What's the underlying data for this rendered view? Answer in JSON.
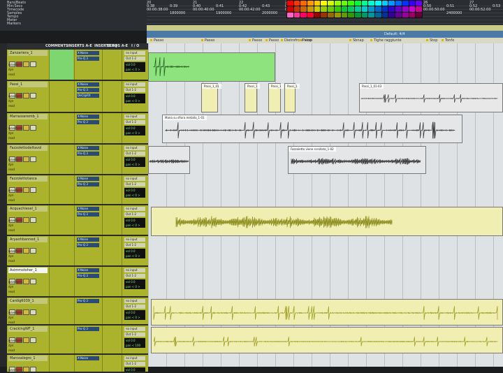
{
  "rulers": [
    {
      "label": "Bars|Beats",
      "ticks": [
        "20",
        "",
        "21",
        "",
        "22",
        "",
        "23",
        "",
        "24",
        "",
        "25",
        "",
        "26",
        "",
        "27",
        "",
        "28"
      ]
    },
    {
      "label": "Min:Secs",
      "ticks": [
        "0:38",
        "0:39",
        "0:40",
        "0:41",
        "0:42",
        "0:43",
        "0:44",
        "0:45",
        "0:46",
        "0:47",
        "0:48",
        "0:49",
        "0:50",
        "0:51",
        "0:52",
        "0:53"
      ]
    },
    {
      "label": "Timecode",
      "ticks": [
        "00:00:38:00",
        "",
        "00:00:40:00",
        "",
        "00:00:42:00",
        "",
        "00:00:44:00",
        "",
        "00:00:46:00",
        "",
        "00:00:48:00",
        "",
        "00:00:50:00",
        "",
        "00:00:52:00"
      ]
    },
    {
      "label": "Samples",
      "ticks": [
        "",
        "1800000",
        "",
        "1900000",
        "",
        "2000000",
        "",
        "2100000",
        "",
        "2200000",
        "",
        "2300000",
        "",
        "2400000",
        ""
      ]
    },
    {
      "label": "Tempo",
      "ticks": []
    },
    {
      "label": "Meter",
      "ticks": []
    },
    {
      "label": "Markers",
      "ticks": []
    }
  ],
  "marker_bar_label": "Default: 4/4",
  "markers": [
    "Passo",
    "Passo",
    "Passo",
    "Passo",
    "Dietrofront stop",
    "Passo",
    "Sbnap",
    "Tighe raggiunte",
    "Stop",
    "Tonfo"
  ],
  "mix_headers": [
    "COMMENTS",
    "INSERTS A-E",
    "INSERTS F-J",
    "SENDS A-E",
    "I / O"
  ],
  "palette_colors": [
    "#ff0000",
    "#ff3300",
    "#ff6600",
    "#ff9900",
    "#ffcc00",
    "#ffff00",
    "#ccff00",
    "#99ff00",
    "#66ff00",
    "#33ff00",
    "#00ff33",
    "#00ff99",
    "#00ffcc",
    "#00ffff",
    "#00ccff",
    "#0099ff",
    "#0066ff",
    "#0033ff",
    "#3300ff",
    "#6600ff",
    "#cc0000",
    "#cc3300",
    "#cc6600",
    "#cc9900",
    "#cccc00",
    "#99cc00",
    "#66cc00",
    "#33cc00",
    "#00cc33",
    "#00cc66",
    "#00cc99",
    "#00cccc",
    "#0099cc",
    "#0066cc",
    "#0033cc",
    "#3300cc",
    "#6600cc",
    "#9900cc",
    "#cc00cc",
    "#cc0099",
    "#ff66cc",
    "#ff3399",
    "#ff0066",
    "#ff0033",
    "#990000",
    "#993300",
    "#996600",
    "#999900",
    "#669900",
    "#339900",
    "#009933",
    "#009966",
    "#009999",
    "#006699",
    "#003399",
    "#330099",
    "#660099",
    "#990099",
    "#990066",
    "#660033"
  ],
  "tracks": [
    {
      "name": "Zanzariera_1",
      "sel": false,
      "h": 45,
      "rows": [
        "waveform",
        "dyn",
        "read"
      ],
      "insA": [
        "X-Noise",
        "Pro-Q 3"
      ],
      "io_in": "no input",
      "io_out": "Out 1-2",
      "vol": "0.0",
      "pan": "< 0 >"
    },
    {
      "name": "Passi_1",
      "sel": false,
      "h": 46,
      "rows": [
        "waveform",
        "dyn",
        "read"
      ],
      "insA": [
        "X-Noise",
        "Pro-Q 3",
        "DeClipRX"
      ],
      "io_in": "no input",
      "io_out": "Out 1-2",
      "vol": "0.0",
      "pan": "< 0 >"
    },
    {
      "name": "Marrasseremb_1",
      "sel": false,
      "h": 45,
      "rows": [
        "waveform",
        "dyn",
        "read"
      ],
      "insA": [
        "X-Noise",
        "Pro-Q 3"
      ],
      "io_in": "no input",
      "io_out": "Out 1-2",
      "vol": "0.0",
      "pan": "< 0 >"
    },
    {
      "name": "Fazzolettodeltavol",
      "sel": false,
      "h": 44,
      "rows": [
        "waveform",
        "dyn",
        "read"
      ],
      "insA": [
        "X-Noise",
        "Pro-Q 3"
      ],
      "io_in": "no input",
      "io_out": "Out 1-2",
      "vol": "0.0",
      "pan": "< 0 >"
    },
    {
      "name": "Fazzolettotasca",
      "sel": false,
      "h": 43,
      "rows": [
        "waveform",
        "dyn",
        "read"
      ],
      "insA": [
        "X-Noise",
        "Pro-Q 3"
      ],
      "io_in": "no input",
      "io_out": "Out 1-2",
      "vol": "0.0",
      "pan": "< 0 >"
    },
    {
      "name": "Acquachiesel_1",
      "sel": false,
      "h": 44,
      "rows": [
        "waveform",
        "dyn",
        "read"
      ],
      "insA": [
        "X-Noise",
        "Pro-Q 3"
      ],
      "io_in": "no input",
      "io_out": "Out 1-2",
      "vol": "0.0",
      "pan": "< 0 >"
    },
    {
      "name": "Aryaohbanned_1",
      "sel": false,
      "h": 44,
      "rows": [
        "waveform",
        "dyn",
        "read"
      ],
      "insA": [
        "X-Noise",
        "Pro-Q 3"
      ],
      "io_in": "no input",
      "io_out": "Out 1-2",
      "vol": "0.0",
      "pan": "< 0 >"
    },
    {
      "name": "Asimmstoher_1",
      "sel": true,
      "h": 44,
      "rows": [
        "waveform",
        "dyn",
        "read"
      ],
      "insA": [
        "X-Noise",
        "Pro-Q 3"
      ],
      "io_in": "no input",
      "io_out": "Out 1-2",
      "vol": "0.0",
      "pan": "< 0 >"
    },
    {
      "name": "Cardig6039_1",
      "sel": false,
      "h": 40,
      "rows": [
        "waveform",
        "dyn",
        "read"
      ],
      "insA": [
        "Pro-Q 3"
      ],
      "io_in": "no input",
      "io_out": "Out 1-2",
      "vol": "0.0",
      "pan": "< 0 >"
    },
    {
      "name": "CrackingWF_1",
      "sel": false,
      "h": 42,
      "rows": [
        "waveform",
        "dyn",
        "read"
      ],
      "insA": [
        "Pro-Q 3"
      ],
      "io_in": "no input",
      "io_out": "Out 1-2",
      "vol": "0.0",
      "pan": "< 100"
    },
    {
      "name": "Marcoalegro_1",
      "sel": false,
      "h": 26,
      "rows": [
        "waveform",
        "dyn",
        "read"
      ],
      "insA": [
        "X-Noise"
      ],
      "io_in": "no input",
      "io_out": "Out 1-2",
      "vol": "0.0",
      "pan": "< 0 >"
    }
  ],
  "clips": [
    {
      "name": "",
      "color": "#8fe37f",
      "track": 0
    },
    {
      "name": "Passi_1_01",
      "color": "#f0eeb0",
      "track": 1
    },
    {
      "name": "Passi_1",
      "color": "#f0eeb0",
      "track": 1
    },
    {
      "name": "Passi_1",
      "color": "#f0eeb0",
      "track": 1
    },
    {
      "name": "Passi_1",
      "color": "#f0eeb0",
      "track": 1
    },
    {
      "name": "Passi_1_01-03",
      "color": "#e8e8e8",
      "track": 1
    },
    {
      "name": "Mano su sfiora metallo_1-01",
      "color": "#e4e6e8",
      "track": 2
    },
    {
      "name": "",
      "color": "#e4e6e8",
      "track": 3
    },
    {
      "name": "Fazzoletto viene scrollato_1-02",
      "color": "#e4e6e8",
      "track": 3
    },
    {
      "name": "",
      "color": "#f0eeb0",
      "track": 5
    },
    {
      "name": "",
      "color": "#f0eeb0",
      "track": 8
    },
    {
      "name": "",
      "color": "#f0eeb0",
      "track": 9
    }
  ]
}
